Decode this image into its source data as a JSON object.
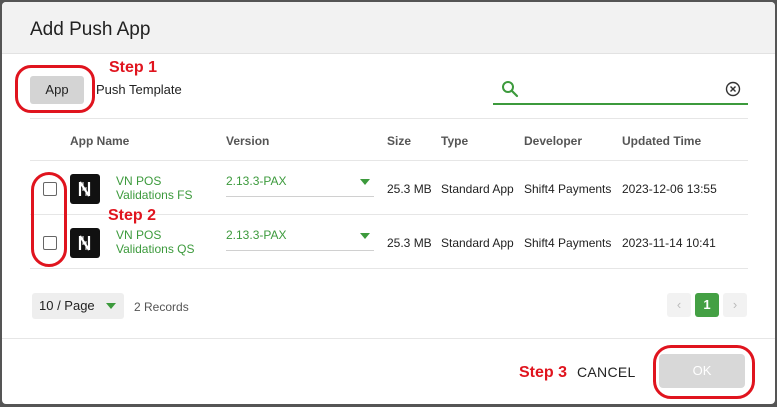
{
  "dialog": {
    "title": "Add Push App"
  },
  "tabs": {
    "app": "App",
    "push_template": "Push Template"
  },
  "search": {
    "value": "",
    "icon": "search-icon",
    "clear_icon": "clear-icon"
  },
  "table": {
    "headers": [
      "App Name",
      "Version",
      "Size",
      "Type",
      "Developer",
      "Updated Time"
    ],
    "rows": [
      {
        "name_line1": "VN POS",
        "name_line2": "Validations FS",
        "version": "2.13.3-PAX",
        "size": "25.3 MB",
        "type": "Standard App",
        "developer": "Shift4 Payments",
        "updated": "2023-12-06 13:55",
        "checked": false
      },
      {
        "name_line1": "VN POS",
        "name_line2": "Validations QS",
        "version": "2.13.3-PAX",
        "size": "25.3 MB",
        "type": "Standard App",
        "developer": "Shift4 Payments",
        "updated": "2023-11-14 10:41",
        "checked": false
      }
    ]
  },
  "pagination": {
    "page_size": "10 / Page",
    "records": "2 Records",
    "prev": "‹",
    "current": "1",
    "next": "›"
  },
  "footer": {
    "cancel": "CANCEL",
    "ok": "OK"
  },
  "annotations": {
    "step1": "Step 1",
    "step2": "Step 2",
    "step3": "Step 3"
  },
  "colors": {
    "accent": "#3c9a3c",
    "annotation": "#e0141e",
    "page_active": "#44a044"
  }
}
